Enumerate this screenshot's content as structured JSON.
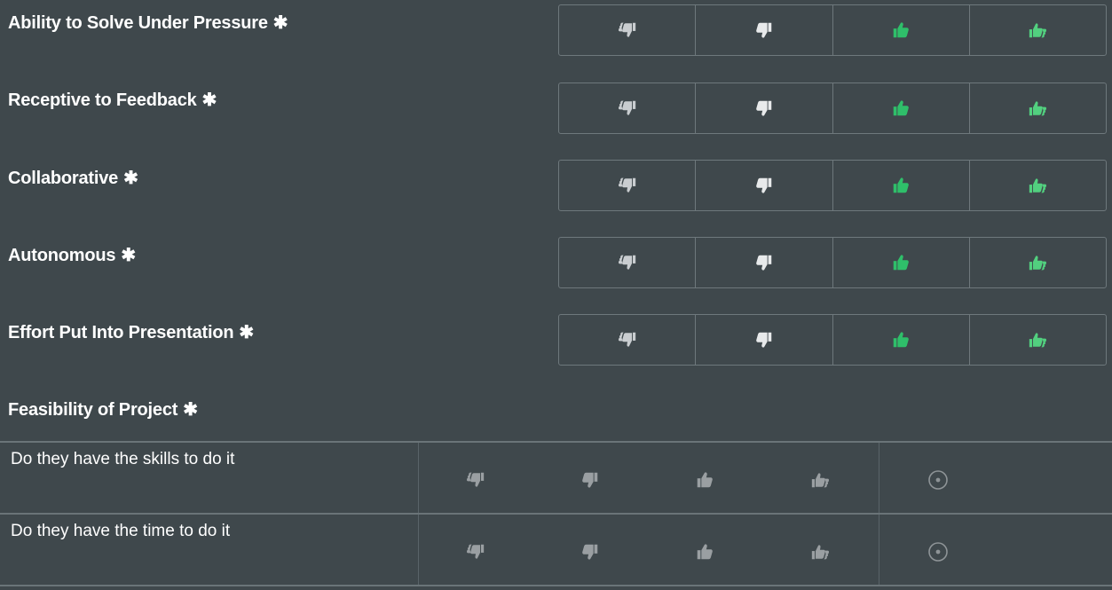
{
  "questions": [
    {
      "label": "Ability to Solve Under Pressure",
      "required_mark": "✱"
    },
    {
      "label": "Receptive to Feedback",
      "required_mark": "✱"
    },
    {
      "label": "Collaborative",
      "required_mark": "✱"
    },
    {
      "label": "Autonomous",
      "required_mark": "✱"
    },
    {
      "label": "Effort Put Into Presentation",
      "required_mark": "✱"
    }
  ],
  "rating_icons": [
    "double-thumbs-down-icon",
    "thumbs-down-icon",
    "thumbs-up-icon",
    "double-thumbs-up-icon"
  ],
  "colors": {
    "background": "#3f484c",
    "negative_icon": "#c9cdd0",
    "positive_icon": "#2fbf6a",
    "positive_icon_light": "#52d07f",
    "matrix_icon": "#9a9fa2"
  },
  "matrix": {
    "title": "Feasibility of Project",
    "required_mark": "✱",
    "rows": [
      {
        "label": "Do they have the skills to do it"
      },
      {
        "label": "Do they have the time to do it"
      }
    ],
    "columns": [
      "double-thumbs-down-icon",
      "thumbs-down-icon",
      "thumbs-up-icon",
      "double-thumbs-up-icon",
      "not-applicable-icon"
    ]
  }
}
